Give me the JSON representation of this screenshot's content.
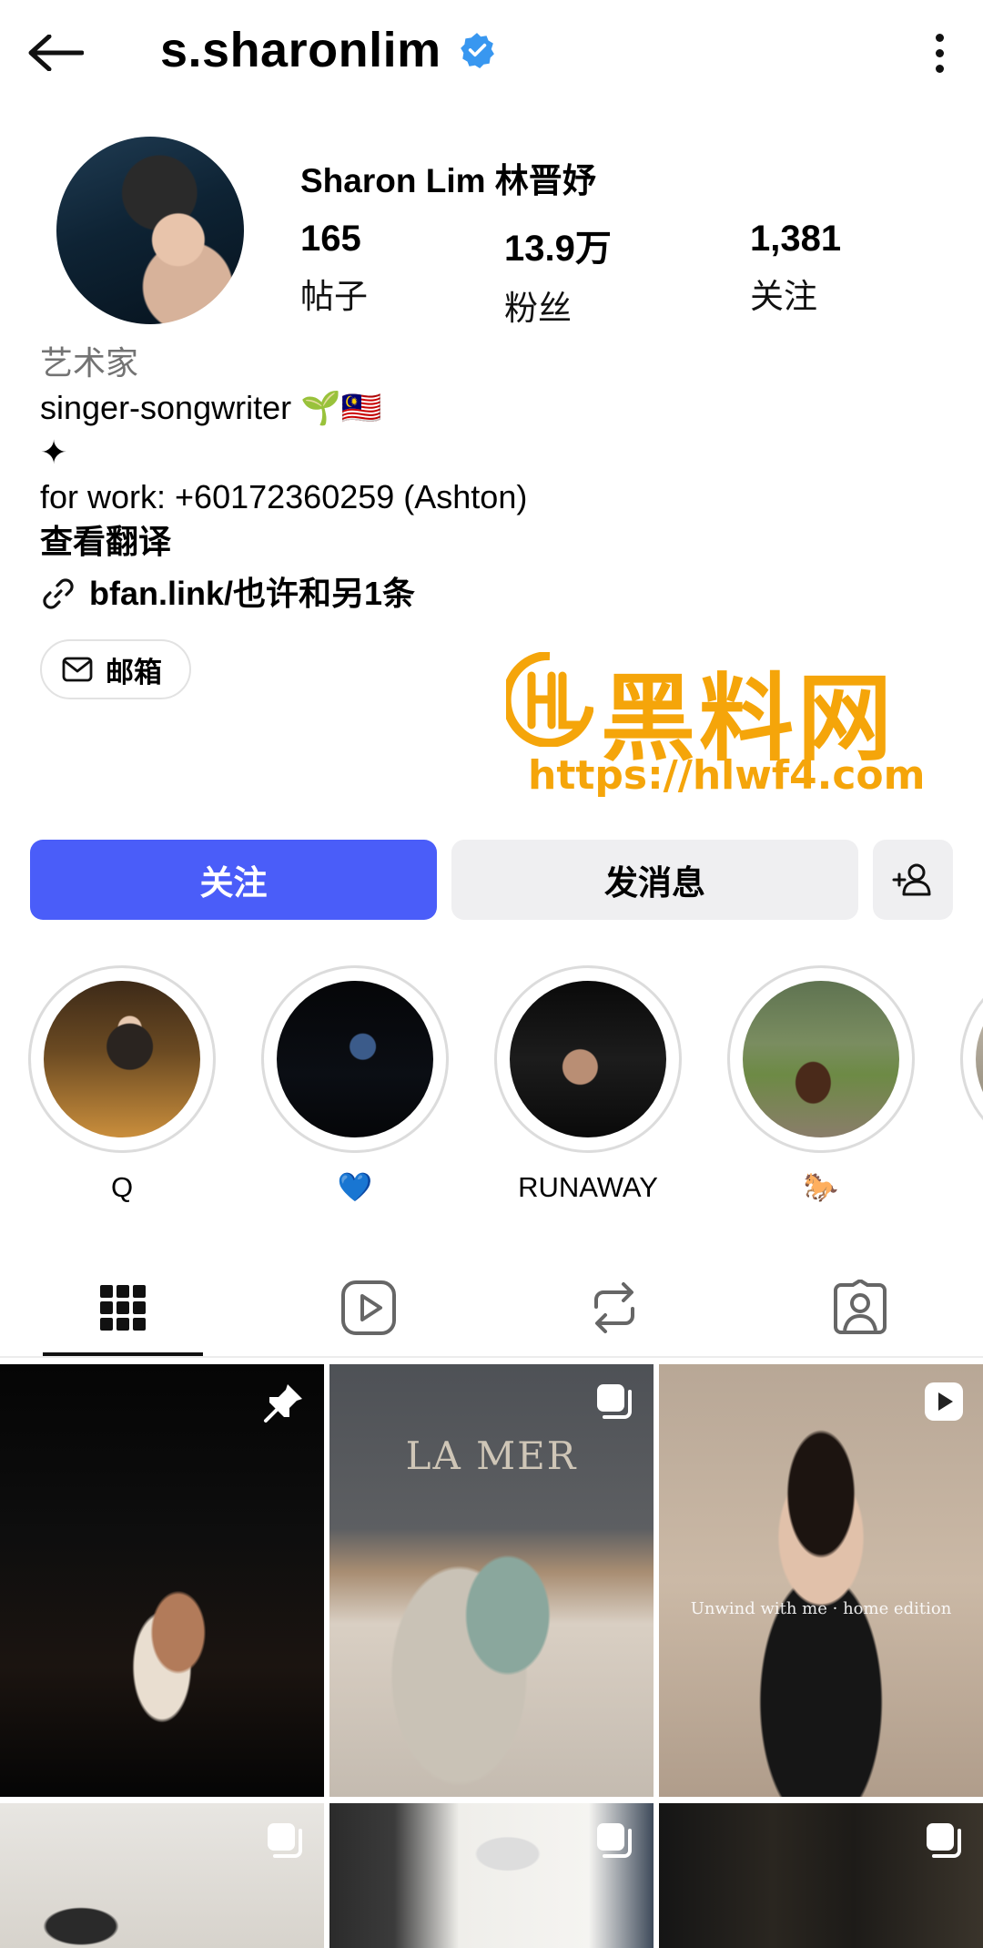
{
  "header": {
    "username": "s.sharonlim"
  },
  "profile": {
    "display_name": "Sharon Lim 林晋妤",
    "stats": [
      {
        "value": "165",
        "label": "帖子"
      },
      {
        "value": "13.9万",
        "label": "粉丝"
      },
      {
        "value": "1,381",
        "label": "关注"
      }
    ],
    "category": "艺术家",
    "bio_lines": [
      "singer-songwriter 🌱🇲🇾",
      "✦",
      "for work: +60172360259 (Ashton)"
    ],
    "translate_label": "查看翻译",
    "link": "bfan.link/也许和另1条",
    "email_label": "邮箱"
  },
  "watermark": {
    "title": "黑料网",
    "url": "https://hlwf4.com",
    "color": "#f5a50a"
  },
  "actions": {
    "follow_label": "关注",
    "message_label": "发消息",
    "follow_color": "#4a5df9"
  },
  "highlights": [
    {
      "label": "Q"
    },
    {
      "label": "💙"
    },
    {
      "label": "RUNAWAY"
    },
    {
      "label": "🐎"
    }
  ],
  "tabs": [
    {
      "icon": "grid-icon",
      "active": true
    },
    {
      "icon": "reels-icon",
      "active": false
    },
    {
      "icon": "reposts-icon",
      "active": false
    },
    {
      "icon": "tagged-icon",
      "active": false
    }
  ],
  "grid": {
    "posts": [
      {
        "badge": "pin-icon"
      },
      {
        "badge": "carousel-icon",
        "text": "LA MER"
      },
      {
        "badge": "reel-icon",
        "text": "Unwind with me · home edition"
      },
      {
        "badge": "carousel-icon"
      },
      {
        "badge": "carousel-icon"
      },
      {
        "badge": "carousel-icon"
      }
    ]
  }
}
